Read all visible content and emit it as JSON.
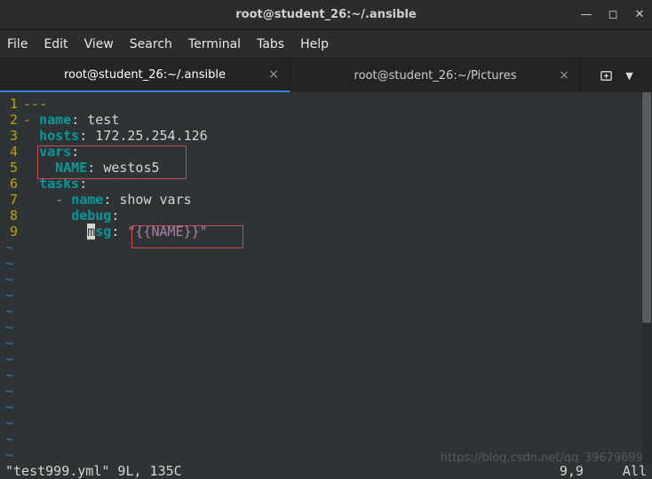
{
  "window": {
    "title": "root@student_26:~/.ansible"
  },
  "menu": {
    "file": "File",
    "edit": "Edit",
    "view": "View",
    "search": "Search",
    "terminal": "Terminal",
    "tabs": "Tabs",
    "help": "Help"
  },
  "tabs": {
    "items": [
      {
        "label": "root@student_26:~/.ansible",
        "active": true
      },
      {
        "label": "root@student_26:~/Pictures",
        "active": false
      }
    ]
  },
  "code": {
    "l1": "---",
    "l2_dash": "- ",
    "l2_key": "name",
    "l2_colon": ": ",
    "l2_val": "test",
    "l3_key": "hosts",
    "l3_colon": ": ",
    "l3_val": "172.25.254.126",
    "l4_key": "vars",
    "l4_colon": ":",
    "l5_key": "NAME",
    "l5_colon": ": ",
    "l5_val": "westos5",
    "l6_key": "tasks",
    "l6_colon": ":",
    "l7_dash": "- ",
    "l7_key": "name",
    "l7_colon": ": ",
    "l7_val": "show vars",
    "l8_key": "debug",
    "l8_colon": ":",
    "l9_cursor": "m",
    "l9_key_rest": "sg",
    "l9_colon": ": ",
    "l9_val": "\"{{NAME}}\""
  },
  "lineno": {
    "n1": "1",
    "n2": "2",
    "n3": "3",
    "n4": "4",
    "n5": "5",
    "n6": "6",
    "n7": "7",
    "n8": "8",
    "n9": "9"
  },
  "tilde": "~",
  "status": {
    "left": "\"test999.yml\" 9L, 135C",
    "pos": "9,9",
    "pct": "All"
  },
  "watermark": "https://blog.csdn.net/qq_39679699"
}
